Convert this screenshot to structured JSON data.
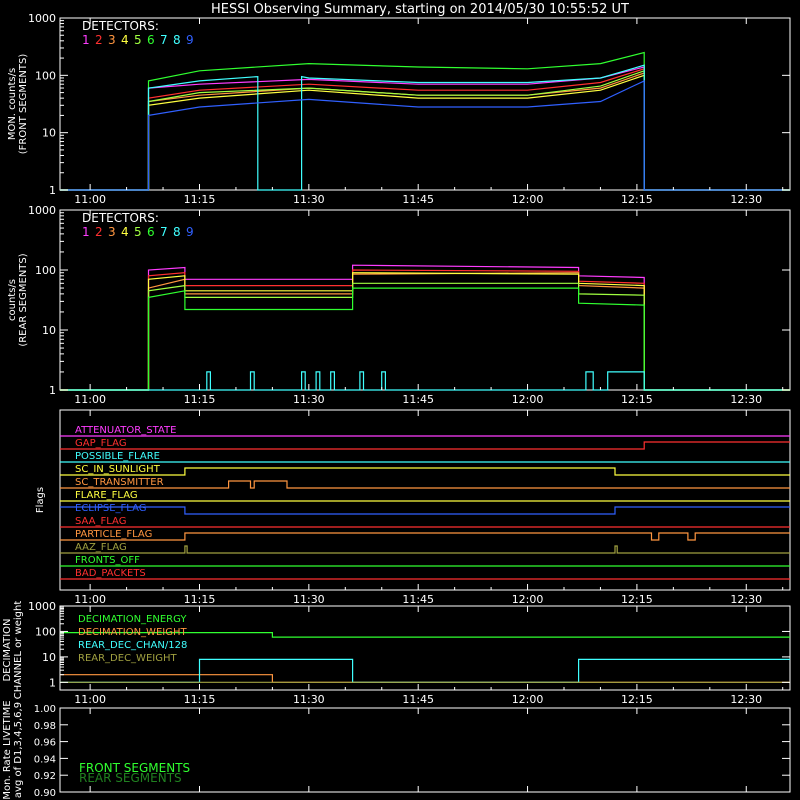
{
  "title": "HESSI Observing Summary, starting on 2014/05/30 10:55:52 UT",
  "time_ticks": [
    "11:00",
    "11:15",
    "11:30",
    "11:45",
    "12:00",
    "12:15",
    "12:30"
  ],
  "colors": {
    "magenta": "#ff3cff",
    "red": "#ff3030",
    "orange": "#ff9640",
    "yellow": "#ffff40",
    "lime": "#a0ff40",
    "green": "#30ff30",
    "cyan": "#40ffff",
    "teal": "#40ffff",
    "blue": "#3060ff",
    "olive": "#a0a040"
  },
  "chart_data": [
    {
      "type": "line",
      "panel": "front",
      "ylabel": "MON. counts/s (FRONT SEGMENTS)",
      "ylabel_lines": [
        "MON. counts/s",
        "(FRONT SEGMENTS)"
      ],
      "ylim": [
        1,
        1000
      ],
      "yscale": "log",
      "yticks": [
        "1",
        "10",
        "100",
        "1000"
      ],
      "legend_title": "DETECTORS:",
      "series": [
        {
          "name": "1",
          "color": "#ff3cff",
          "x": [
            "10:55:52",
            "11:08",
            "11:08",
            "11:15",
            "11:30",
            "11:45",
            "12:00",
            "12:10",
            "12:16",
            "12:16",
            "12:36"
          ],
          "y": [
            1,
            1,
            60,
            70,
            85,
            70,
            70,
            90,
            140,
            1,
            1
          ]
        },
        {
          "name": "2",
          "color": "#ff3030",
          "x": [
            "10:55:52",
            "11:08",
            "11:08",
            "11:15",
            "11:30",
            "11:45",
            "12:00",
            "12:10",
            "12:16",
            "12:16",
            "12:36"
          ],
          "y": [
            1,
            1,
            40,
            55,
            70,
            55,
            55,
            75,
            130,
            1,
            1
          ]
        },
        {
          "name": "3",
          "color": "#ff9640",
          "x": [
            "10:55:52",
            "11:08",
            "11:08",
            "11:15",
            "11:30",
            "11:45",
            "12:00",
            "12:10",
            "12:16",
            "12:16",
            "12:36"
          ],
          "y": [
            1,
            1,
            35,
            45,
            60,
            45,
            45,
            60,
            110,
            1,
            1
          ]
        },
        {
          "name": "4",
          "color": "#ffff40",
          "x": [
            "10:55:52",
            "11:08",
            "11:08",
            "11:15",
            "11:30",
            "11:45",
            "12:00",
            "12:10",
            "12:16",
            "12:16",
            "12:36"
          ],
          "y": [
            1,
            1,
            30,
            40,
            55,
            40,
            40,
            55,
            100,
            1,
            1
          ]
        },
        {
          "name": "5",
          "color": "#a0ff40",
          "x": [
            "10:55:52",
            "11:08",
            "11:08",
            "11:15",
            "11:30",
            "11:45",
            "12:00",
            "12:10",
            "12:16",
            "12:16",
            "12:36"
          ],
          "y": [
            1,
            1,
            35,
            50,
            60,
            45,
            45,
            65,
            120,
            1,
            1
          ]
        },
        {
          "name": "6",
          "color": "#30ff30",
          "x": [
            "10:55:52",
            "11:08",
            "11:08",
            "11:15",
            "11:30",
            "11:45",
            "12:00",
            "12:10",
            "12:16",
            "12:16",
            "12:36"
          ],
          "y": [
            1,
            1,
            80,
            120,
            160,
            140,
            130,
            160,
            250,
            1,
            1
          ]
        },
        {
          "name": "7",
          "color": "#40ffff",
          "x": [
            "10:55:52",
            "11:08",
            "11:08",
            "11:15",
            "11:23",
            "11:23",
            "11:29",
            "11:29",
            "11:30",
            "11:45",
            "12:00",
            "12:10",
            "12:16",
            "12:16",
            "12:36"
          ],
          "y": [
            1,
            1,
            60,
            80,
            95,
            1,
            1,
            95,
            90,
            75,
            75,
            90,
            150,
            1,
            1
          ]
        },
        {
          "name": "8",
          "color": "#40ffff",
          "x": [],
          "y": []
        },
        {
          "name": "9",
          "color": "#3060ff",
          "x": [
            "10:55:52",
            "11:08",
            "11:08",
            "11:15",
            "11:30",
            "11:45",
            "12:00",
            "12:10",
            "12:16",
            "12:16",
            "12:36"
          ],
          "y": [
            1,
            1,
            20,
            28,
            38,
            28,
            28,
            35,
            80,
            1,
            1
          ]
        }
      ]
    },
    {
      "type": "line",
      "panel": "rear",
      "ylabel": "counts/s (REAR SEGMENTS)",
      "ylabel_lines": [
        "counts/s",
        "(REAR SEGMENTS)"
      ],
      "ylim": [
        1,
        1000
      ],
      "yscale": "log",
      "yticks": [
        "1",
        "10",
        "100",
        "1000"
      ],
      "legend_title": "DETECTORS:",
      "series": [
        {
          "name": "1",
          "color": "#ff3cff",
          "x": [
            "10:55:52",
            "11:08",
            "11:08",
            "11:13",
            "11:13",
            "11:36",
            "11:36",
            "12:07",
            "12:07",
            "12:16",
            "12:16",
            "12:36"
          ],
          "y": [
            1,
            1,
            100,
            110,
            70,
            70,
            120,
            110,
            80,
            75,
            1,
            1
          ]
        },
        {
          "name": "2",
          "color": "#ff3030",
          "x": [
            "10:55:52",
            "11:08",
            "11:08",
            "11:13",
            "11:13",
            "11:36",
            "11:36",
            "12:07",
            "12:07",
            "12:16",
            "12:16",
            "12:36"
          ],
          "y": [
            1,
            1,
            80,
            90,
            55,
            55,
            100,
            95,
            65,
            60,
            1,
            1
          ]
        },
        {
          "name": "3",
          "color": "#ff9640",
          "x": [
            "10:55:52",
            "11:08",
            "11:08",
            "11:13",
            "11:13",
            "11:36",
            "11:36",
            "12:07",
            "12:07",
            "12:16",
            "12:16",
            "12:36"
          ],
          "y": [
            1,
            1,
            50,
            70,
            40,
            40,
            85,
            90,
            55,
            50,
            1,
            1
          ]
        },
        {
          "name": "4",
          "color": "#ffff40",
          "x": [
            "10:55:52",
            "11:08",
            "11:08",
            "11:13",
            "11:13",
            "11:36",
            "11:36",
            "12:07",
            "12:07",
            "12:16",
            "12:16",
            "12:36"
          ],
          "y": [
            1,
            1,
            70,
            80,
            45,
            45,
            90,
            85,
            60,
            55,
            1,
            1
          ]
        },
        {
          "name": "5",
          "color": "#a0ff40",
          "x": [
            "10:55:52",
            "11:08",
            "11:08",
            "11:13",
            "11:13",
            "11:36",
            "11:36",
            "12:07",
            "12:07",
            "12:16",
            "12:16",
            "12:36"
          ],
          "y": [
            1,
            1,
            45,
            55,
            35,
            35,
            60,
            60,
            40,
            38,
            1,
            1
          ]
        },
        {
          "name": "6",
          "color": "#30ff30",
          "x": [
            "10:55:52",
            "11:08",
            "11:08",
            "11:13",
            "11:13",
            "11:36",
            "11:36",
            "12:07",
            "12:07",
            "12:16",
            "12:16",
            "12:36"
          ],
          "y": [
            1,
            1,
            35,
            45,
            22,
            22,
            50,
            50,
            28,
            26,
            1,
            1
          ]
        },
        {
          "name": "7",
          "color": "#40ffff",
          "x": [
            "10:55:52",
            "11:16",
            "11:16",
            "11:16.5",
            "11:16.5",
            "11:22",
            "11:22",
            "11:22.5",
            "11:22.5",
            "11:29",
            "11:29",
            "11:29.5",
            "11:29.5",
            "11:31",
            "11:31",
            "11:31.5",
            "11:31.5",
            "11:33",
            "11:33",
            "11:33.5",
            "11:33.5",
            "11:37",
            "11:37",
            "11:37.5",
            "11:37.5",
            "11:40",
            "11:40",
            "11:40.5",
            "11:40.5",
            "12:08",
            "12:08",
            "12:09",
            "12:09",
            "12:11",
            "12:11",
            "12:16",
            "12:16",
            "12:36"
          ],
          "y": [
            1,
            1,
            2,
            2,
            1,
            1,
            2,
            2,
            1,
            1,
            2,
            2,
            1,
            1,
            2,
            2,
            1,
            1,
            2,
            2,
            1,
            1,
            2,
            2,
            1,
            1,
            2,
            2,
            1,
            1,
            2,
            2,
            1,
            1,
            2,
            2,
            1,
            1
          ]
        },
        {
          "name": "8",
          "color": "#40ffff",
          "x": [],
          "y": []
        },
        {
          "name": "9",
          "color": "#3060ff",
          "x": [],
          "y": []
        }
      ]
    },
    {
      "type": "line",
      "panel": "flags",
      "ylabel": "Flags",
      "flags": [
        {
          "name": "ATTENUATOR_STATE",
          "color": "#ff3cff",
          "x": [
            "10:55:52",
            "12:36"
          ],
          "state": [
            0,
            0
          ]
        },
        {
          "name": "GAP_FLAG",
          "color": "#ff3030",
          "x": [
            "10:55:52",
            "12:16",
            "12:16",
            "12:36"
          ],
          "state": [
            0,
            0,
            1,
            1
          ]
        },
        {
          "name": "POSSIBLE_FLARE",
          "color": "#40ffff",
          "x": [
            "10:55:52",
            "12:36"
          ],
          "state": [
            0,
            0
          ]
        },
        {
          "name": "SC_IN_SUNLIGHT",
          "color": "#ffff40",
          "x": [
            "10:55:52",
            "11:13",
            "11:13",
            "12:12",
            "12:12",
            "12:36"
          ],
          "state": [
            0,
            0,
            1,
            1,
            0,
            0
          ]
        },
        {
          "name": "SC_TRANSMITTER",
          "color": "#ff9640",
          "x": [
            "10:55:52",
            "11:19",
            "11:19",
            "11:22",
            "11:22",
            "11:22.5",
            "11:22.5",
            "11:27",
            "11:27",
            "12:36"
          ],
          "state": [
            0,
            0,
            1,
            1,
            0,
            0,
            1,
            1,
            0,
            0
          ]
        },
        {
          "name": "FLARE_FLAG",
          "color": "#ffff40",
          "x": [
            "10:55:52",
            "12:36"
          ],
          "state": [
            0,
            0
          ]
        },
        {
          "name": "ECLIPSE_FLAG",
          "color": "#3060ff",
          "x": [
            "10:55:52",
            "11:13",
            "11:13",
            "12:12",
            "12:12",
            "12:36"
          ],
          "state": [
            1,
            1,
            0,
            0,
            1,
            1
          ]
        },
        {
          "name": "SAA_FLAG",
          "color": "#ff3030",
          "x": [
            "10:55:52",
            "12:36"
          ],
          "state": [
            0,
            0
          ]
        },
        {
          "name": "PARTICLE_FLAG",
          "color": "#ff9640",
          "x": [
            "10:55:52",
            "11:13",
            "11:13",
            "12:17",
            "12:17",
            "12:18",
            "12:18",
            "12:22",
            "12:22",
            "12:23",
            "12:23",
            "12:36"
          ],
          "state": [
            0,
            0,
            1,
            1,
            0,
            0,
            1,
            1,
            0,
            0,
            1,
            1
          ]
        },
        {
          "name": "AAZ_FLAG",
          "color": "#a0a040",
          "x": [
            "10:55:52",
            "11:13",
            "11:13",
            "11:13.3",
            "11:13.3",
            "12:12",
            "12:12",
            "12:12.3",
            "12:12.3",
            "12:36"
          ],
          "state": [
            0,
            0,
            1,
            1,
            0,
            0,
            1,
            1,
            0,
            0
          ]
        },
        {
          "name": "FRONTS_OFF",
          "color": "#30ff30",
          "x": [
            "10:55:52",
            "12:36"
          ],
          "state": [
            0,
            0
          ]
        },
        {
          "name": "BAD_PACKETS",
          "color": "#ff3030",
          "x": [
            "10:55:52",
            "12:36"
          ],
          "state": [
            0,
            0
          ]
        }
      ]
    },
    {
      "type": "line",
      "panel": "decimation",
      "ylabel": "DECIMATION CHANNEL or weight",
      "ylabel_lines": [
        "DECIMATION",
        "CHANNEL or weight"
      ],
      "ylim": [
        0.5,
        1000
      ],
      "yscale": "log",
      "yticks": [
        "1",
        "10",
        "100",
        "1000"
      ],
      "series": [
        {
          "name": "DECIMATION_ENERGY",
          "color": "#30ff30",
          "x": [
            "10:55:52",
            "11:25",
            "11:25",
            "12:36"
          ],
          "y": [
            90,
            90,
            60,
            60
          ]
        },
        {
          "name": "DECIMATION_WEIGHT",
          "color": "#ff9640",
          "x": [
            "10:55:52",
            "11:25",
            "11:25",
            "12:36"
          ],
          "y": [
            2,
            2,
            1,
            1
          ]
        },
        {
          "name": "REAR_DEC_CHAN/128",
          "color": "#40ffff",
          "x": [
            "10:55:52",
            "11:15",
            "11:15",
            "11:36",
            "11:36",
            "12:07",
            "12:07",
            "12:36"
          ],
          "y": [
            1,
            1,
            8,
            8,
            1,
            1,
            8,
            8
          ]
        },
        {
          "name": "REAR_DEC_WEIGHT",
          "color": "#a0a040",
          "x": [
            "10:55:52",
            "12:36"
          ],
          "y": [
            1,
            1
          ]
        }
      ]
    },
    {
      "type": "line",
      "panel": "livetime",
      "ylabel": "Mon. Rate LIVETIME avg of D1,3,4,5,6,9",
      "ylabel_lines": [
        "Mon. Rate LIVETIME",
        "avg of D1,3,4,5,6,9"
      ],
      "ylim": [
        0.9,
        1.0
      ],
      "yticks": [
        "0.90",
        "0.92",
        "0.94",
        "0.96",
        "0.98",
        "1.00"
      ],
      "series": [
        {
          "name": "FRONT SEGMENTS",
          "color": "#30ff30",
          "x": [],
          "y": []
        },
        {
          "name": "REAR SEGMENTS",
          "color": "#208020",
          "x": [],
          "y": []
        }
      ]
    }
  ]
}
